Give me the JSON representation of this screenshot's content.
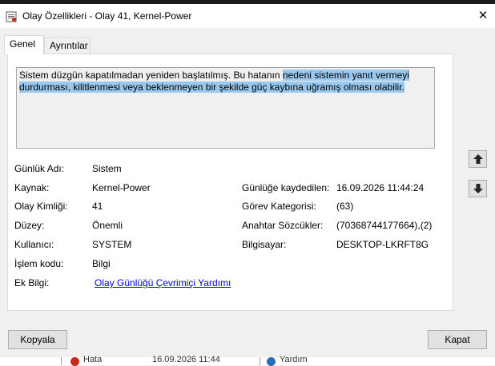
{
  "window": {
    "title": "Olay Özellikleri - Olay 41, Kernel-Power",
    "close_glyph": "✕"
  },
  "tabs": [
    {
      "label": "Genel",
      "active": true
    },
    {
      "label": "Ayrıntılar",
      "active": false
    }
  ],
  "description": {
    "plain_part": "Sistem düzgün kapatılmadan yeniden başlatılmış. Bu hatanın ",
    "selected_part": "nedeni sistemin yanıt vermeyi durdurması, kilitlenmesi veya beklenmeyen bir şekilde güç kaybına uğramış olması olabilir."
  },
  "fields": {
    "log_name_label": "Günlük Adı:",
    "log_name_value": "Sistem",
    "source_label": "Kaynak:",
    "source_value": "Kernel-Power",
    "logged_label": "Günlüğe kaydedilen:",
    "logged_value": "16.09.2026 11:44:24",
    "event_id_label": "Olay Kimliği:",
    "event_id_value": "41",
    "task_category_label": "Görev Kategorisi:",
    "task_category_value": "(63)",
    "level_label": "Düzey:",
    "level_value": "Önemli",
    "keywords_label": "Anahtar Sözcükler:",
    "keywords_value": "(70368744177664),(2)",
    "user_label": "Kullanıcı:",
    "user_value": "SYSTEM",
    "computer_label": "Bilgisayar:",
    "computer_value": "DESKTOP-LKRFT8G",
    "opcode_label": "İşlem kodu:",
    "opcode_value": "Bilgi",
    "more_info_label": "Ek Bilgi:",
    "more_info_link": "Olay Günlüğü Çevrimiçi Yardımı"
  },
  "nav": {
    "up_icon": "arrow-up-icon",
    "down_icon": "arrow-down-icon"
  },
  "buttons": {
    "copy": "Kopyala",
    "close": "Kapat"
  },
  "background_list": {
    "level_text": "Hata",
    "date_text": "16.09.2026 11:44",
    "category_text": "Yardım"
  },
  "colors": {
    "selection": "#99c9ef",
    "link": "#0000ee",
    "error": "#c42b1c"
  }
}
